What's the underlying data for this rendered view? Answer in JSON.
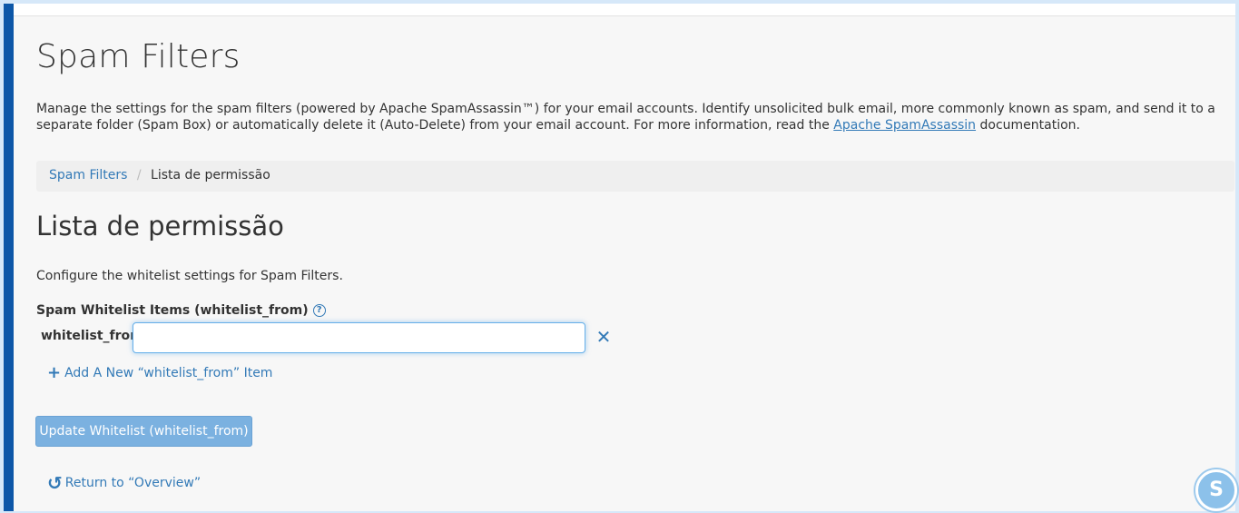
{
  "page": {
    "title": "Spam Filters",
    "description_before_link": "Manage the settings for the spam filters (powered by Apache SpamAssassin™) for your email accounts. Identify unsolicited bulk email, more commonly known as spam, and send it to a separate folder (Spam Box) or automatically delete it (Auto-Delete) from your email account. For more information, read the ",
    "description_link": "Apache SpamAssassin",
    "description_after_link": " documentation."
  },
  "breadcrumb": {
    "parent": "Spam Filters",
    "separator": "/",
    "current": "Lista de permissão"
  },
  "section": {
    "title": "Lista de permissão",
    "description": "Configure the whitelist settings for Spam Filters."
  },
  "form": {
    "field_label": "Spam Whitelist Items (whitelist_from)",
    "help_icon": "question-circle-icon",
    "row_label": "whitelist_from",
    "input_value": "",
    "input_placeholder": "",
    "remove_icon": "close-icon",
    "add_item_label": "Add A New “whitelist_from” Item",
    "add_icon": "plus-icon",
    "submit_label": "Update Whitelist (whitelist_from)"
  },
  "footer": {
    "return_label": "Return to “Overview”",
    "return_icon": "undo-icon"
  },
  "colors": {
    "accent": "#337ab7",
    "sidebar_bar": "#0d57a8",
    "button_disabled": "#7bb1e0"
  }
}
